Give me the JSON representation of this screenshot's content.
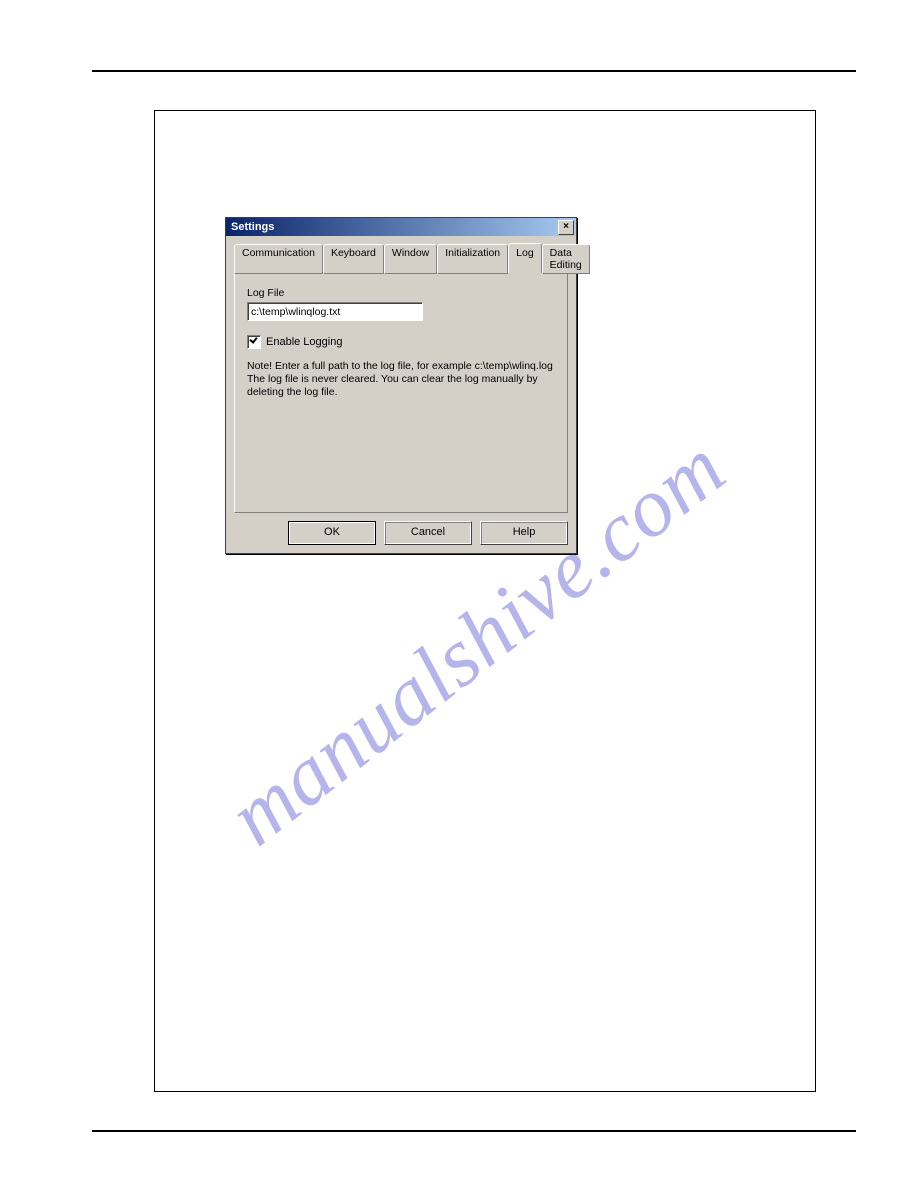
{
  "watermark": "manualshive.com",
  "dialog": {
    "title": "Settings",
    "close_glyph": "×",
    "tabs": [
      {
        "label": "Communication"
      },
      {
        "label": "Keyboard"
      },
      {
        "label": "Window"
      },
      {
        "label": "Initialization"
      },
      {
        "label": "Log"
      },
      {
        "label": "Data Editing"
      }
    ],
    "log_file_label": "Log File",
    "log_file_value": "c:\\temp\\wlinqlog.txt",
    "enable_logging_label": "Enable Logging",
    "note_text": "Note! Enter a full path to the log file, for example c:\\temp\\wlinq.log The log file is never cleared. You can clear the log manually by deleting the log file.",
    "buttons": {
      "ok": "OK",
      "cancel": "Cancel",
      "help": "Help"
    }
  }
}
